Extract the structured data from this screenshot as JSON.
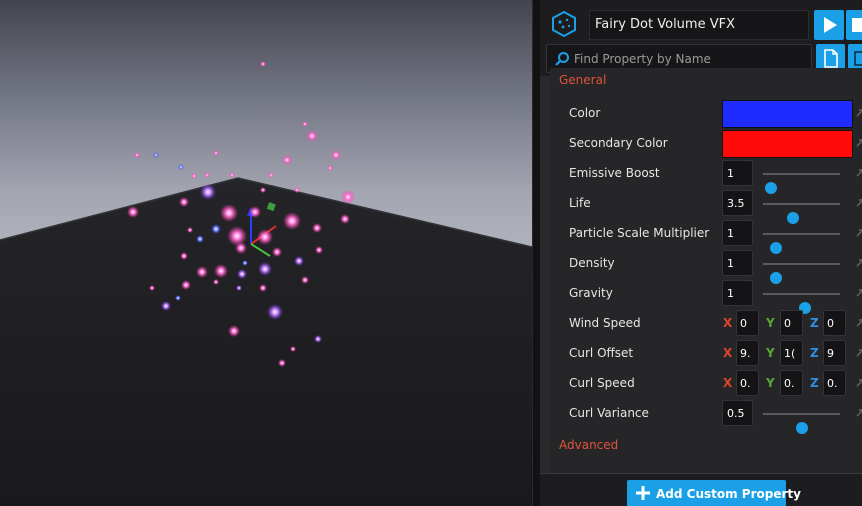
{
  "viewport": {
    "label": "3D viewport"
  },
  "header": {
    "asset_name": "Fairy Dot Volume VFX",
    "search_placeholder": "Find Property by Name",
    "icons": [
      "vfx-asset-icon",
      "play-icon",
      "stop-icon",
      "search-icon",
      "document-icon",
      "layout-icon"
    ]
  },
  "sections": {
    "general": "General",
    "advanced": "Advanced"
  },
  "properties": {
    "color": {
      "label": "Color",
      "value": "#1e2cff"
    },
    "secondary_color": {
      "label": "Secondary Color",
      "value": "#ff0a0a"
    },
    "emissive_boost": {
      "label": "Emissive Boost",
      "value": "1",
      "slider": 0.11
    },
    "life": {
      "label": "Life",
      "value": "3.5",
      "slider": 0.39
    },
    "particle_scale_multiplier": {
      "label": "Particle Scale Multiplier",
      "value": "1",
      "slider": 0.17
    },
    "density": {
      "label": "Density",
      "value": "1",
      "slider": 0.17
    },
    "gravity": {
      "label": "Gravity",
      "value": "1",
      "slider": 0.54
    },
    "wind_speed": {
      "label": "Wind Speed",
      "x": "0",
      "y": "0",
      "z": "0"
    },
    "curl_offset": {
      "label": "Curl Offset",
      "x": "9.",
      "y": "1(",
      "z": "9"
    },
    "curl_speed": {
      "label": "Curl Speed",
      "x": "0.",
      "y": "0.",
      "z": "0."
    },
    "curl_variance": {
      "label": "Curl Variance",
      "value": "0.5",
      "slider": 0.5
    }
  },
  "axis_labels": {
    "x": "X",
    "y": "Y",
    "z": "Z"
  },
  "footer": {
    "add_button": "Add Custom Property"
  },
  "colors": {
    "accent": "#1ba0e8",
    "section": "#e0533c",
    "panel_bg": "#29292b"
  }
}
